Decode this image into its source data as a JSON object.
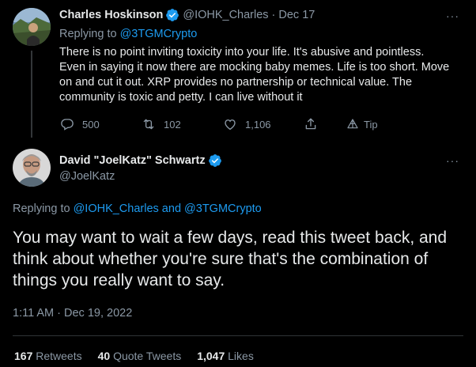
{
  "parent_tweet": {
    "author_name": "Charles Hoskinson",
    "author_handle": "@IOHK_Charles",
    "separator": "·",
    "date": "Dec 17",
    "replying_prefix": "Replying to ",
    "replying_to": "@3TGMCrypto",
    "text": "There is no point inviting toxicity into your life. It's abusive and pointless. Even in saying it now there are mocking baby memes. Life is too short. Move on and cut it out. XRP provides no partnership or technical value. The community is toxic and petty. I can live without it",
    "reply_count": "500",
    "retweet_count": "102",
    "like_count": "1,106",
    "tip_label": "Tip",
    "more": "···"
  },
  "main_tweet": {
    "author_name": "David \"JoelKatz\" Schwartz",
    "author_handle": "@JoelKatz",
    "replying_prefix": "Replying to ",
    "replying_to_1": "@IOHK_Charles",
    "replying_and": " and ",
    "replying_to_2": "@3TGMCrypto",
    "text": "You may want to wait a few days, read this tweet back, and think about whether you're sure that's the combination of things you really want to say.",
    "timestamp": "1:11 AM · Dec 19, 2022",
    "more": "···"
  },
  "stats": {
    "retweets_count": "167",
    "retweets_label": " Retweets",
    "quotes_count": "40",
    "quotes_label": " Quote Tweets",
    "likes_count": "1,047",
    "likes_label": " Likes"
  },
  "colors": {
    "background": "#000000",
    "text": "#e7e9ea",
    "secondary": "#8b98a5",
    "link": "#1d9bf0",
    "verified": "#1d9bf0",
    "divider": "#2f3336"
  },
  "icons": {
    "reply": "speech-bubble-icon",
    "retweet": "retweet-arrows-icon",
    "like": "heart-icon",
    "share": "share-upload-icon",
    "tip": "tip-icon",
    "verified": "verified-badge-icon",
    "more": "ellipsis-icon"
  }
}
